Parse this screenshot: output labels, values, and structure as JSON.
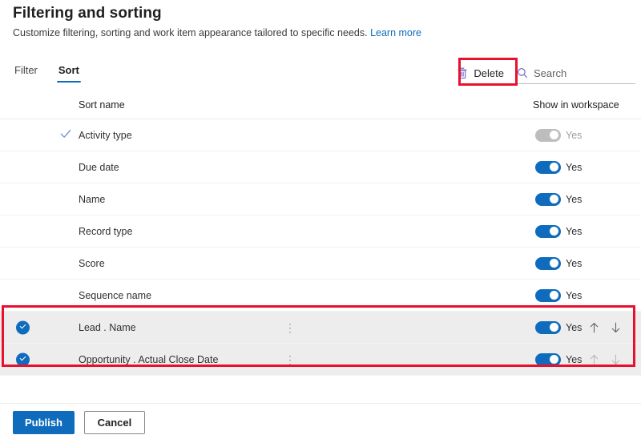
{
  "header": {
    "title": "Filtering and sorting",
    "subtitle": "Customize filtering, sorting and work item appearance tailored to specific needs.",
    "learn_more": "Learn more"
  },
  "tabs": [
    {
      "label": "Filter",
      "active": false
    },
    {
      "label": "Sort",
      "active": true
    }
  ],
  "toolbar": {
    "delete_label": "Delete",
    "delete_icon": "trash-icon",
    "search_placeholder": "Search",
    "search_value": "",
    "search_icon": "search-icon"
  },
  "table": {
    "columns": {
      "name": "Sort name",
      "show_in_workspace": "Show in workspace"
    },
    "rows": [
      {
        "label": "Activity type",
        "selected": false,
        "leading_icon": "check-mark-icon",
        "toggle": "off",
        "toggle_text": "Yes",
        "toggle_dim": true,
        "more": false,
        "arrows": "none"
      },
      {
        "label": "Due date",
        "selected": false,
        "leading_icon": "none",
        "toggle": "on",
        "toggle_text": "Yes",
        "toggle_dim": false,
        "more": false,
        "arrows": "none"
      },
      {
        "label": "Name",
        "selected": false,
        "leading_icon": "none",
        "toggle": "on",
        "toggle_text": "Yes",
        "toggle_dim": false,
        "more": false,
        "arrows": "none"
      },
      {
        "label": "Record type",
        "selected": false,
        "leading_icon": "none",
        "toggle": "on",
        "toggle_text": "Yes",
        "toggle_dim": false,
        "more": false,
        "arrows": "none"
      },
      {
        "label": "Score",
        "selected": false,
        "leading_icon": "none",
        "toggle": "on",
        "toggle_text": "Yes",
        "toggle_dim": false,
        "more": false,
        "arrows": "none"
      },
      {
        "label": "Sequence name",
        "selected": false,
        "leading_icon": "none",
        "toggle": "on",
        "toggle_text": "Yes",
        "toggle_dim": false,
        "more": false,
        "arrows": "none"
      },
      {
        "label": "Lead . Name",
        "selected": true,
        "leading_icon": "check-circle-icon",
        "toggle": "on",
        "toggle_text": "Yes",
        "toggle_dim": false,
        "more": true,
        "arrows": "both"
      },
      {
        "label": "Opportunity . Actual Close Date",
        "selected": true,
        "leading_icon": "check-circle-icon",
        "toggle": "on",
        "toggle_text": "Yes",
        "toggle_dim": false,
        "more": true,
        "arrows": "up-only"
      }
    ],
    "more_glyph": "⋮"
  },
  "footer": {
    "publish_label": "Publish",
    "cancel_label": "Cancel"
  },
  "annotations": [
    {
      "name": "delete-button-highlight",
      "color": "#e8112d"
    },
    {
      "name": "selected-rows-highlight",
      "color": "#e8112d"
    }
  ]
}
